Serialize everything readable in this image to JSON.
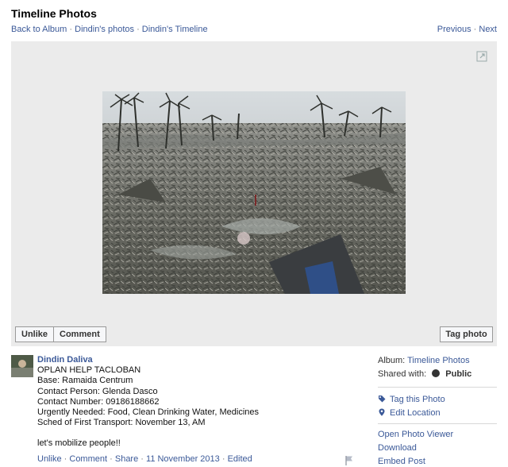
{
  "header": {
    "title": "Timeline Photos",
    "crumbs": [
      "Back to Album",
      "Dindin's photos",
      "Dindin's Timeline"
    ],
    "crumb_sep": "·",
    "previous": "Previous",
    "next": "Next"
  },
  "stage": {
    "expand_icon": "expand-icon",
    "unlike": "Unlike",
    "comment": "Comment",
    "tag_photo": "Tag photo"
  },
  "post": {
    "author": "Dindin Daliva",
    "lines": [
      "OPLAN HELP TACLOBAN",
      "Base: Ramaida Centrum",
      "Contact Person: Glenda Dasco",
      "Contact Number: 09186188662",
      "Urgently Needed: Food, Clean Drinking Water, Medicines",
      "Sched of First Transport: November 13, AM"
    ],
    "closing": "let's mobilize people!!",
    "actions": {
      "unlike": "Unlike",
      "comment": "Comment",
      "share": "Share",
      "date": "11 November 2013",
      "edited": "Edited"
    }
  },
  "sidebar": {
    "album_label": "Album:",
    "album_value": "Timeline Photos",
    "shared_label": "Shared with:",
    "shared_value": "Public",
    "tag_this": "Tag this Photo",
    "edit_location": "Edit Location",
    "open_viewer": "Open Photo Viewer",
    "download": "Download",
    "embed": "Embed Post"
  },
  "colors": {
    "link": "#3b5998",
    "stage_bg": "#ebebeb",
    "button_bg": "#f6f7f9"
  }
}
